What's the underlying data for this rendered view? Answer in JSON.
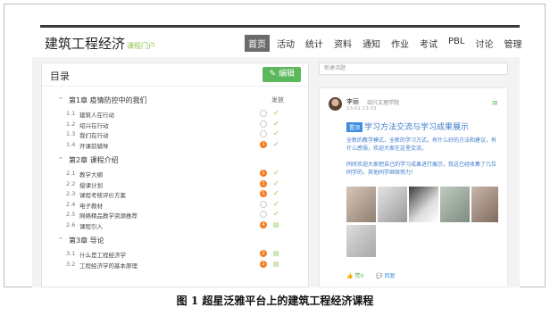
{
  "brand": {
    "title": "建筑工程经济",
    "subtitle": "课程门户"
  },
  "nav": {
    "items": [
      "首页",
      "活动",
      "统计",
      "资料",
      "通知",
      "作业",
      "考试",
      "PBL",
      "讨论",
      "管理"
    ],
    "active": "首页"
  },
  "toc": {
    "title": "目录",
    "edit_label": "编辑",
    "chapters": [
      {
        "title": "第1章 疫情防控中的我们",
        "extra": "发放",
        "sections": [
          {
            "num": "1.1",
            "title": "建筑人在行动",
            "status": "empty",
            "mark": "check"
          },
          {
            "num": "1.2",
            "title": "绍兴在行动",
            "status": "empty",
            "mark": "check"
          },
          {
            "num": "1.3",
            "title": "我们在行动",
            "status": "empty",
            "mark": "check"
          },
          {
            "num": "1.4",
            "title": "开课前辅导",
            "status": "orange",
            "badge": "1",
            "mark": "check"
          }
        ]
      },
      {
        "title": "第2章 课程介绍",
        "extra": "",
        "sections": [
          {
            "num": "2.1",
            "title": "教学大纲",
            "status": "orange",
            "badge": "1",
            "mark": "check"
          },
          {
            "num": "2.2",
            "title": "授课计划",
            "status": "orange",
            "badge": "1",
            "mark": "check"
          },
          {
            "num": "2.3",
            "title": "课程考核评价方案",
            "status": "orange",
            "badge": "1",
            "mark": "check"
          },
          {
            "num": "2.4",
            "title": "电子教材",
            "status": "empty",
            "mark": "check"
          },
          {
            "num": "2.5",
            "title": "网络精品教学资源推荐",
            "status": "empty",
            "mark": "check"
          },
          {
            "num": "2.6",
            "title": "课程引入",
            "status": "orange",
            "badge": "4",
            "mark": "doc"
          }
        ]
      },
      {
        "title": "第3章 导论",
        "extra": "",
        "sections": [
          {
            "num": "3.1",
            "title": "什么是工程经济学",
            "status": "orange",
            "badge": "2",
            "mark": "doc"
          },
          {
            "num": "3.2",
            "title": "工程经济学的基本原理",
            "status": "orange",
            "badge": "2",
            "mark": "doc"
          }
        ]
      }
    ]
  },
  "activity": {
    "search_placeholder": "新建活题",
    "post": {
      "user": "李丽",
      "school": "绍兴文理学院",
      "time": "03-01 13:33",
      "tag": "置顶",
      "title": "学习方法交流与学习成果展示",
      "paragraphs": [
        "全新的教学模式，全新的学习方式，有什么好的方法和建议，有什么感悟，欢迎大家在这里交流。",
        "同时欢迎大家把自己的学习成果进行展示，我这已经收集了几位同学的，其他同学继续努力！"
      ],
      "actions": {
        "like": "赞0",
        "reply": "回复"
      }
    }
  },
  "caption": "图 1  超星泛雅平台上的建筑工程经济课程"
}
